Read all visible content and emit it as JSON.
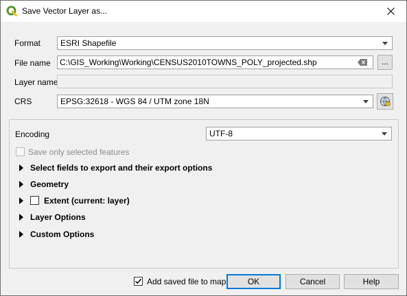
{
  "window": {
    "title": "Save Vector Layer as..."
  },
  "form": {
    "format_label": "Format",
    "format_value": "ESRI Shapefile",
    "filename_label": "File name",
    "filename_value": "C:\\GIS_Working\\Working\\CENSUS2010TOWNS_POLY_projected.shp",
    "browse_label": "...",
    "layername_label": "Layer name",
    "layername_value": "",
    "crs_label": "CRS",
    "crs_value": "EPSG:32618 - WGS 84 / UTM zone 18N"
  },
  "options": {
    "encoding_label": "Encoding",
    "encoding_value": "UTF-8",
    "selected_only_label": "Save only selected features",
    "sections": [
      "Select fields to export and their export options",
      "Geometry",
      "Extent (current: layer)",
      "Layer Options",
      "Custom Options"
    ]
  },
  "footer": {
    "add_to_map_label": "Add saved file to map",
    "add_to_map_checked": true,
    "ok_label": "OK",
    "cancel_label": "Cancel",
    "help_label": "Help"
  },
  "colors": {
    "accent": "#0078d7",
    "qgis_green": "#589632",
    "qgis_yellow": "#eebd31"
  }
}
